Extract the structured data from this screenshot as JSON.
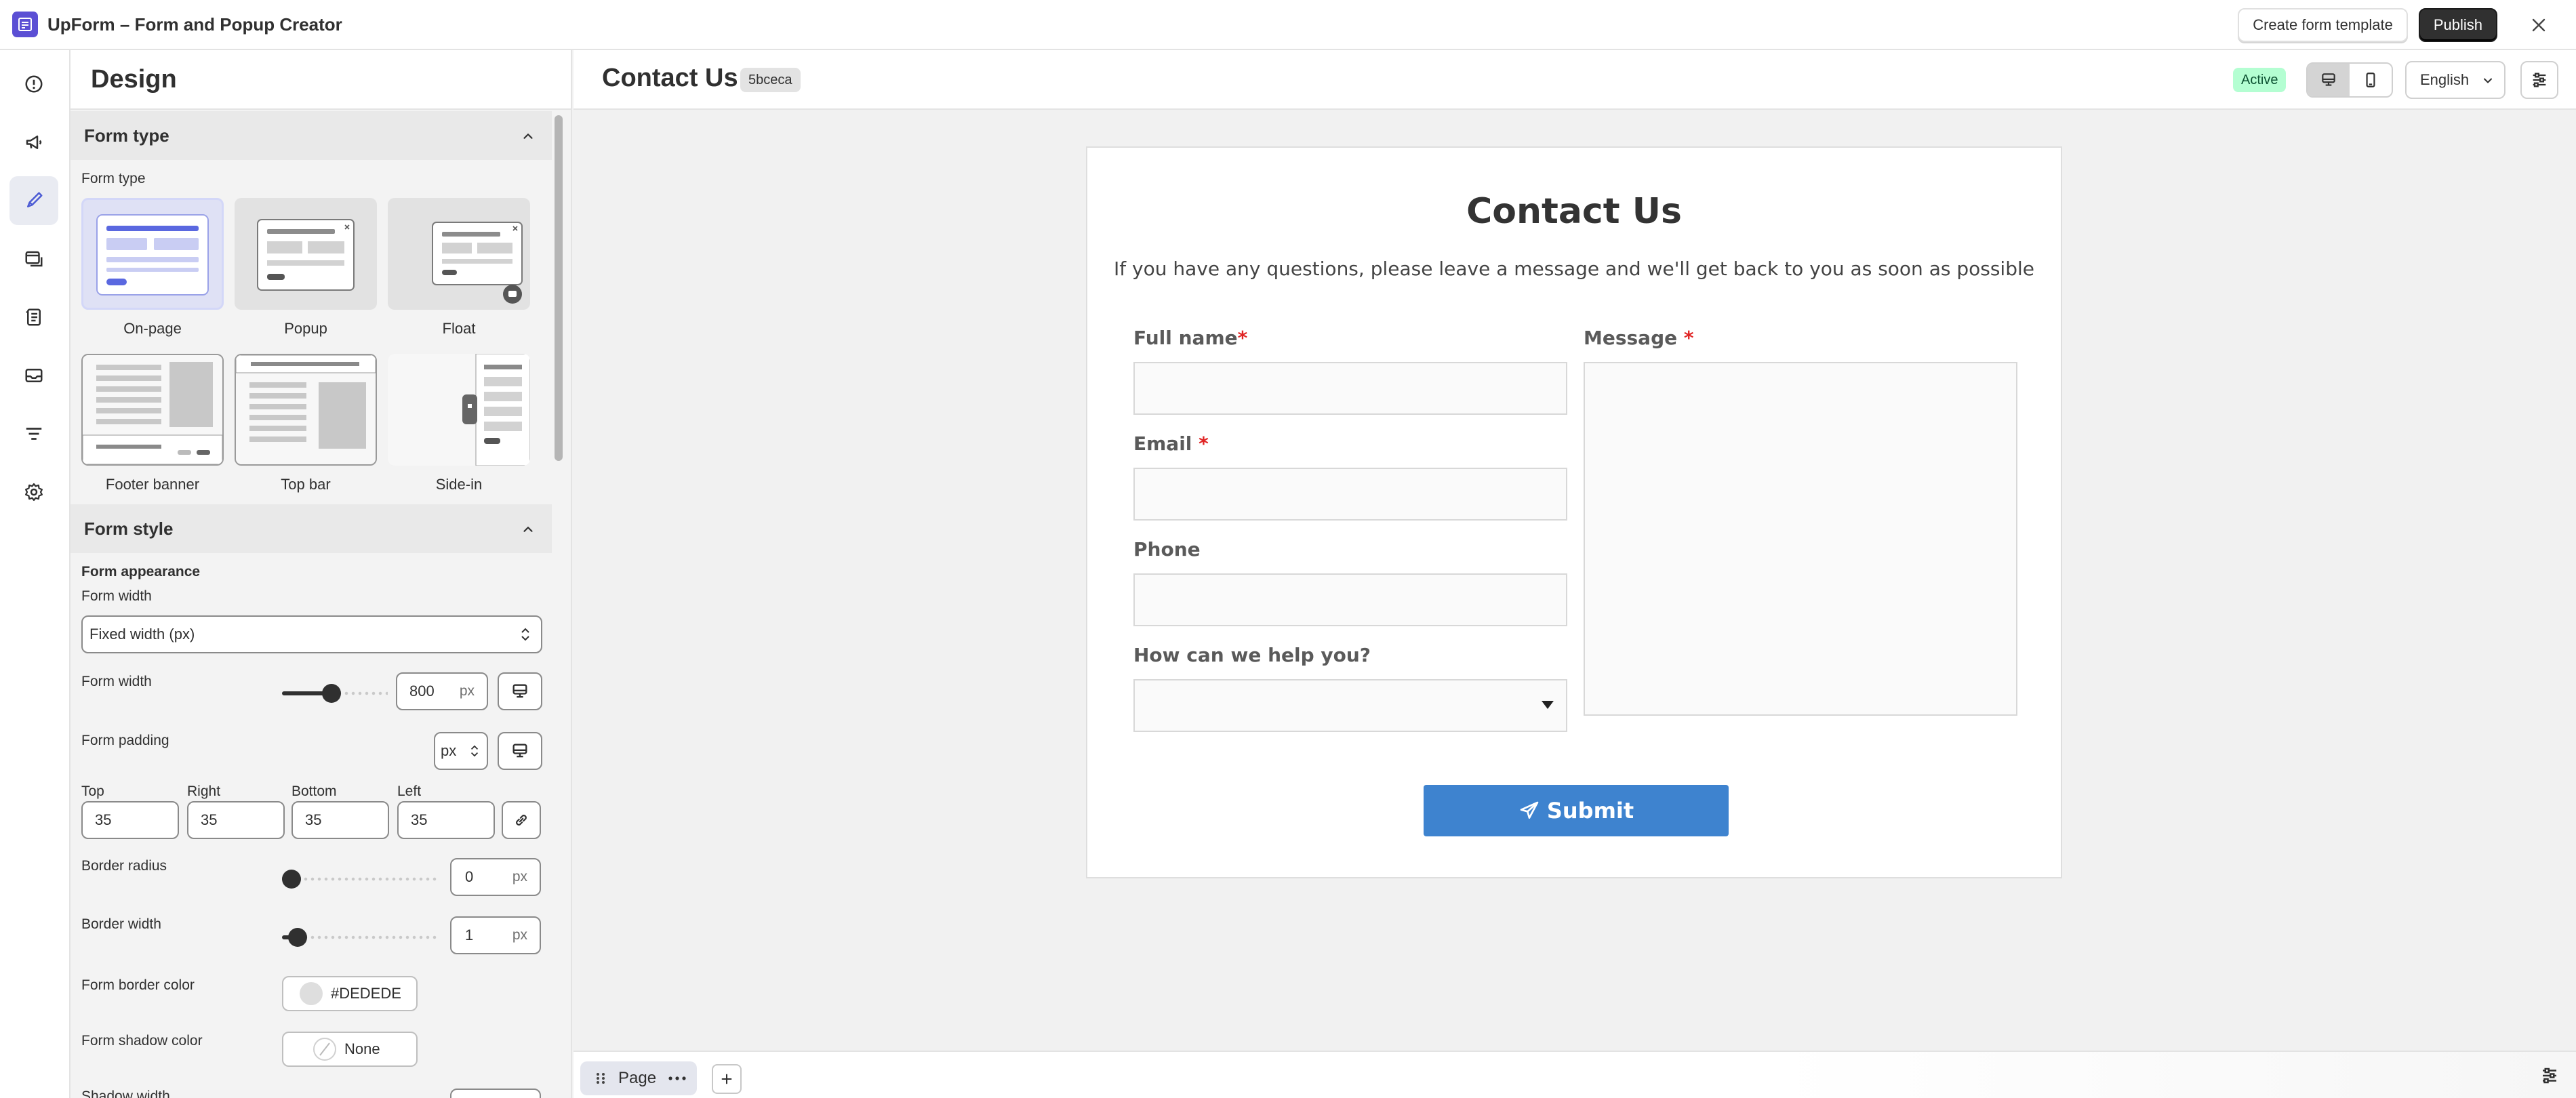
{
  "app": {
    "title": "UpForm – Form and Popup Creator",
    "create_template_label": "Create form template",
    "publish_label": "Publish"
  },
  "rail": {
    "items": [
      "info-icon",
      "megaphone-icon",
      "brush-icon",
      "layout-icon",
      "list-icon",
      "mail-icon",
      "filter-icon",
      "gear-icon"
    ],
    "active": "brush-icon"
  },
  "design": {
    "title": "Design",
    "form_type_section": {
      "header": "Form type",
      "label": "Form type",
      "options": [
        "On-page",
        "Popup",
        "Float",
        "Footer banner",
        "Top bar",
        "Side-in"
      ],
      "selected": "On-page"
    },
    "form_style_section": {
      "header": "Form style",
      "appearance_heading": "Form appearance",
      "width_mode_label": "Form width",
      "width_mode_value": "Fixed width (px)",
      "width_label": "Form width",
      "width_value": "800",
      "width_unit": "px",
      "width_slider_fraction": 0.38,
      "padding_label": "Form padding",
      "padding_unit": "px",
      "padding": {
        "top_label": "Top",
        "top": "35",
        "right_label": "Right",
        "right": "35",
        "bottom_label": "Bottom",
        "bottom": "35",
        "left_label": "Left",
        "left": "35"
      },
      "border_radius_label": "Border radius",
      "border_radius_value": "0",
      "border_radius_unit": "px",
      "border_radius_fraction": 0.0,
      "border_width_label": "Border width",
      "border_width_value": "1",
      "border_width_unit": "px",
      "border_width_fraction": 0.04,
      "border_color_label": "Form border color",
      "border_color_value": "#DEDEDE",
      "shadow_color_label": "Form shadow color",
      "shadow_color_value": "None",
      "next_label_partial": "Shadow width"
    }
  },
  "canvas": {
    "page_title": "Contact Us",
    "form_id": "5bceca",
    "status": "Active",
    "language": "English",
    "device": "desktop"
  },
  "form_preview": {
    "title": "Contact Us",
    "subtitle": "If you have any questions, please leave a message and we'll get back to you as soon as possible",
    "fields": {
      "full_name": "Full name",
      "email": "Email",
      "phone": "Phone",
      "help": "How can we help you?",
      "message": "Message"
    },
    "required_mark": "*",
    "submit_label": "Submit"
  },
  "pages": {
    "tab_label": "Page"
  },
  "colors": {
    "accent": "#3e83cf",
    "status_bg": "#b4fed2",
    "brand": "#5b4fd4",
    "required": "#e02424"
  }
}
